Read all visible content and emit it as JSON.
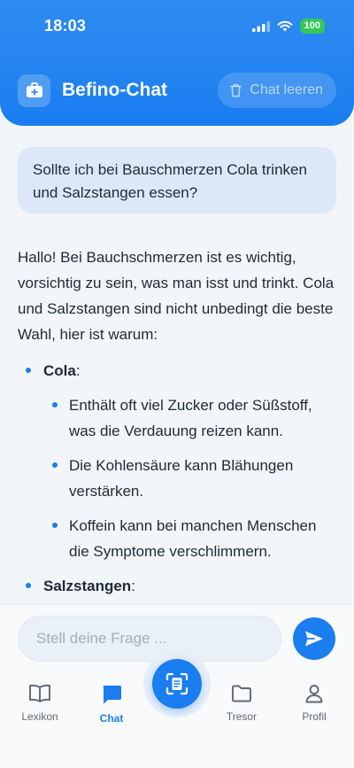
{
  "status_bar": {
    "time": "18:03",
    "battery": "100"
  },
  "header": {
    "title": "Befino-Chat",
    "clear_label": "Chat leeren"
  },
  "chat": {
    "user_message": "Sollte ich bei Bauschmerzen Cola trinken und Salzstangen essen?",
    "answer_intro": "Hallo! Bei Bauchschmerzen ist es wichtig, vorsichtig zu sein, was man isst und trinkt. Cola und Salzstangen sind nicht unbedingt die beste Wahl, hier ist warum:",
    "sections": [
      {
        "title": "Cola",
        "suffix": ":",
        "points": [
          "Enthält oft viel Zucker oder Süßstoff, was die Verdauung reizen kann.",
          "Die Kohlensäure kann Blähungen verstärken.",
          "Koffein kann bei manchen Menschen die Symptome verschlimmern."
        ]
      },
      {
        "title": "Salzstangen",
        "suffix": ":"
      }
    ]
  },
  "composer": {
    "placeholder": "Stell deine Frage ..."
  },
  "nav": {
    "items": [
      {
        "label": "Lexikon",
        "icon": "book-icon"
      },
      {
        "label": "Chat",
        "icon": "chat-icon",
        "active": true
      },
      {
        "label": "Tresor",
        "icon": "folder-icon"
      },
      {
        "label": "Profil",
        "icon": "person-icon"
      }
    ],
    "center_icon": "scan-document-icon"
  },
  "colors": {
    "accent": "#1A7DF0",
    "battery": "#34C759",
    "user_bubble": "#DCE8F7"
  }
}
